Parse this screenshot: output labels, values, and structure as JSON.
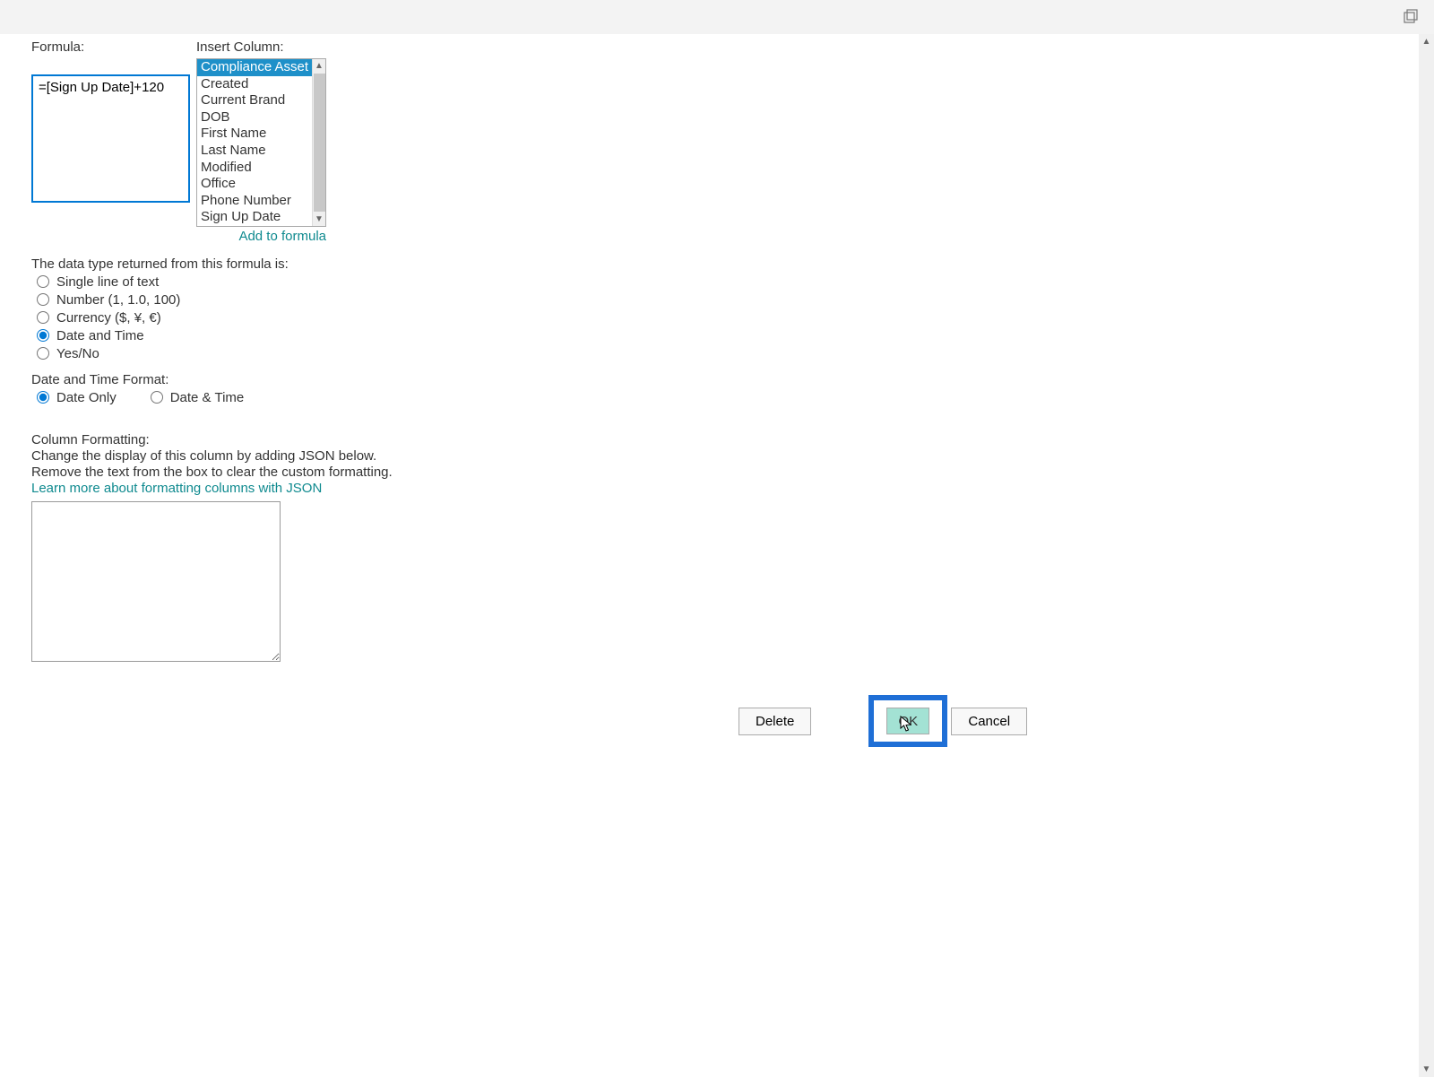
{
  "labels": {
    "formula": "Formula:",
    "insert_column": "Insert Column:",
    "add_to_formula": "Add to formula",
    "data_type_returned": "The data type returned from this formula is:",
    "date_time_format": "Date and Time Format:",
    "column_formatting": "Column Formatting:",
    "col_format_desc1": "Change the display of this column by adding JSON below.",
    "col_format_desc2": "Remove the text from the box to clear the custom formatting.",
    "learn_more": "Learn more about formatting columns with JSON"
  },
  "formula_value": "=[Sign Up Date]+120",
  "columns": [
    "Compliance Asset Id",
    "Created",
    "Current Brand",
    "DOB",
    "First Name",
    "Last Name",
    "Modified",
    "Office",
    "Phone Number",
    "Sign Up Date"
  ],
  "selected_column_index": 0,
  "data_types": {
    "single_line": "Single line of text",
    "number": "Number (1, 1.0, 100)",
    "currency": "Currency ($, ¥, €)",
    "date_time": "Date and Time",
    "yes_no": "Yes/No"
  },
  "data_type_selected": "date_time",
  "dt_formats": {
    "date_only": "Date Only",
    "date_and_time": "Date & Time"
  },
  "dt_format_selected": "date_only",
  "json_value": "",
  "buttons": {
    "delete": "Delete",
    "ok": "OK",
    "cancel": "Cancel"
  }
}
